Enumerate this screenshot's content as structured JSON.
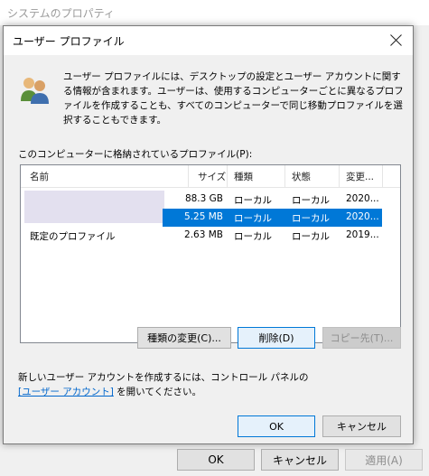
{
  "parent_window": {
    "title": "システムのプロパティ",
    "buttons": {
      "ok": "OK",
      "cancel": "キャンセル",
      "apply": "適用(A)"
    }
  },
  "dialog": {
    "title": "ユーザー プロファイル",
    "description": "ユーザー プロファイルには、デスクトップの設定とユーザー アカウントに関する情報が含まれます。ユーザーは、使用するコンピューターごとに異なるプロファイルを作成することも、すべてのコンピューターで同じ移動プロファイルを選択することもできます。",
    "list_label": "このコンピューターに格納されているプロファイル(P):",
    "columns": [
      "名前",
      "サイズ",
      "種類",
      "状態",
      "変更..."
    ],
    "rows": [
      {
        "name": "",
        "size": "88.3 GB",
        "type": "ローカル",
        "status": "ローカル",
        "modified": "2020...",
        "selected": false
      },
      {
        "name": "",
        "size": "5.25 MB",
        "type": "ローカル",
        "status": "ローカル",
        "modified": "2020...",
        "selected": true
      },
      {
        "name": "既定のプロファイル",
        "size": "2.63 MB",
        "type": "ローカル",
        "status": "ローカル",
        "modified": "2019...",
        "selected": false
      }
    ],
    "buttons": {
      "change_type": "種類の変更(C)...",
      "delete": "削除(D)",
      "copy_to": "コピー先(T)...",
      "ok": "OK",
      "cancel": "キャンセル"
    },
    "info_line1": "新しいユーザー アカウントを作成するには、コントロール パネルの",
    "info_link": "[ユーザー アカウント]",
    "info_line2": " を開いてください。",
    "selection_color": "#0078d7"
  }
}
